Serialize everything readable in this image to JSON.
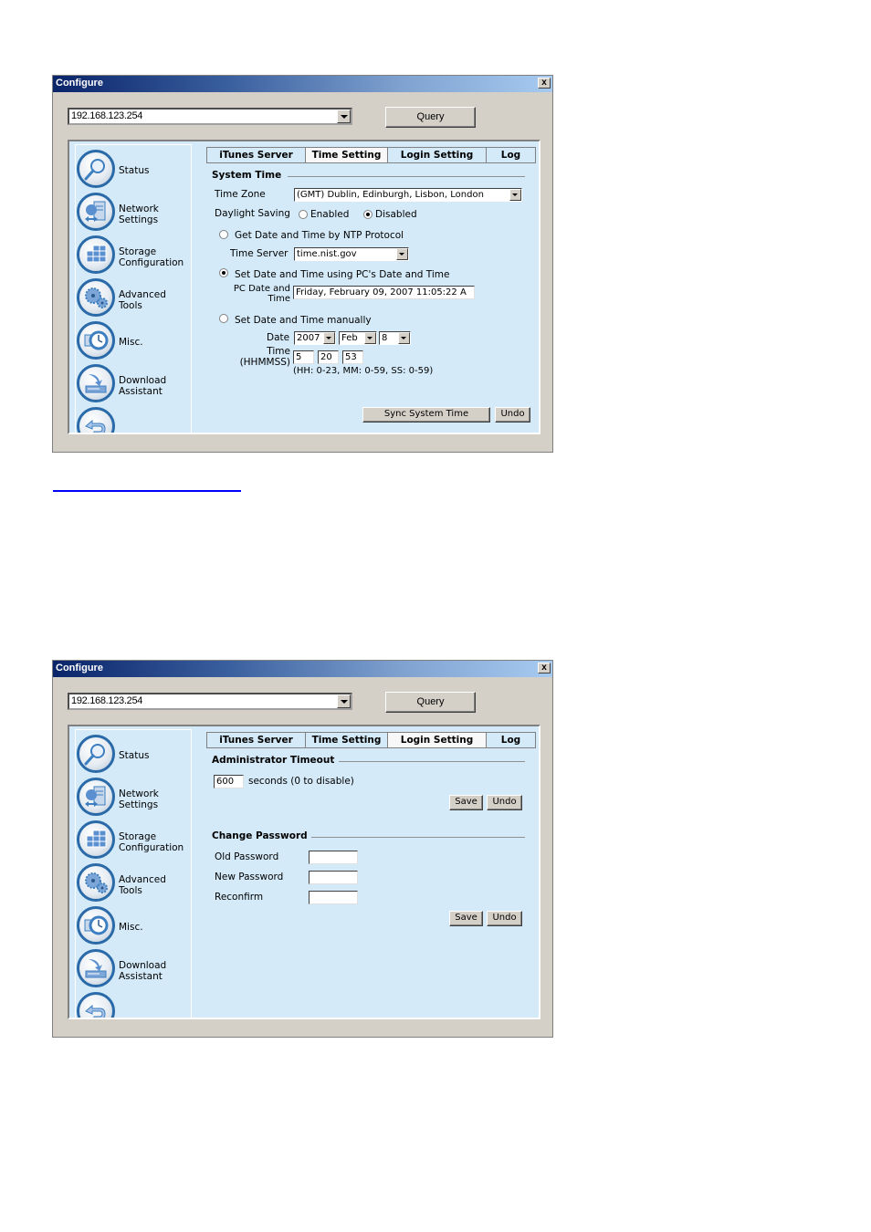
{
  "windows": [
    {
      "title": "Configure",
      "close_label": "x",
      "ip_address": "192.168.123.254",
      "query_label": "Query",
      "sidebar": [
        {
          "label_line1": "Status",
          "label_line2": "",
          "icon": "magnifier-icon"
        },
        {
          "label_line1": "Network",
          "label_line2": "Settings",
          "icon": "network-icon"
        },
        {
          "label_line1": "Storage",
          "label_line2": "Configuration",
          "icon": "storage-icon"
        },
        {
          "label_line1": "Advanced",
          "label_line2": "Tools",
          "icon": "gears-icon"
        },
        {
          "label_line1": "Misc.",
          "label_line2": "",
          "icon": "clock-icon"
        },
        {
          "label_line1": "Download",
          "label_line2": "Assistant",
          "icon": "download-icon"
        },
        {
          "label_line1": "Logout",
          "label_line2": "",
          "icon": "logout-icon"
        }
      ],
      "tabs": [
        "iTunes Server",
        "Time Setting",
        "Login Setting",
        "Log"
      ],
      "active_tab": "Time Setting",
      "time_setting": {
        "section_title": "System Time",
        "time_zone_label": "Time Zone",
        "time_zone_value": "(GMT) Dublin, Edinburgh, Lisbon, London",
        "daylight_label": "Daylight Saving",
        "daylight_enabled_label": "Enabled",
        "daylight_disabled_label": "Disabled",
        "daylight_selected": "Disabled",
        "ntp_option_label": "Get Date and Time by NTP Protocol",
        "time_server_label": "Time Server",
        "time_server_value": "time.nist.gov",
        "pc_option_label": "Set Date and Time using PC's Date and Time",
        "pc_datetime_label_1": "PC Date and",
        "pc_datetime_label_2": "Time",
        "pc_datetime_value": "Friday, February 09, 2007 11:05:22 A",
        "manual_option_label": "Set Date and Time manually",
        "selected_option": "pc",
        "date_label": "Date",
        "date_year": "2007",
        "date_month": "Feb",
        "date_day": "8",
        "time_label_1": "Time",
        "time_label_2": "(HHMMSS)",
        "time_hh": "5",
        "time_mm": "20",
        "time_ss": "53",
        "time_hint": "(HH: 0-23, MM: 0-59, SS: 0-59)",
        "sync_label": "Sync System Time",
        "undo_label": "Undo"
      }
    },
    {
      "title": "Configure",
      "close_label": "x",
      "ip_address": "192.168.123.254",
      "query_label": "Query",
      "tabs": [
        "iTunes Server",
        "Time Setting",
        "Login Setting",
        "Log"
      ],
      "active_tab": "Login Setting",
      "login_setting": {
        "timeout_section_title": "Administrator Timeout",
        "timeout_value": "600",
        "timeout_hint": "seconds (0 to disable)",
        "save_label": "Save",
        "undo_label": "Undo",
        "password_section_title": "Change Password",
        "old_password_label": "Old Password",
        "new_password_label": "New Password",
        "reconfirm_label": "Reconfirm",
        "old_password_value": "",
        "new_password_value": "",
        "reconfirm_value": "",
        "save2_label": "Save",
        "undo2_label": "Undo"
      }
    }
  ]
}
